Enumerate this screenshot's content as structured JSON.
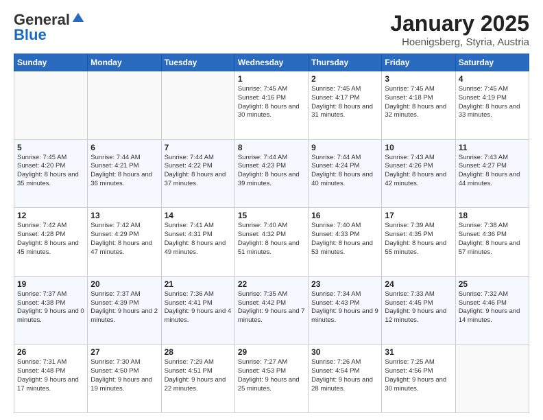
{
  "logo": {
    "general": "General",
    "blue": "Blue"
  },
  "title": "January 2025",
  "subtitle": "Hoenigsberg, Styria, Austria",
  "days_header": [
    "Sunday",
    "Monday",
    "Tuesday",
    "Wednesday",
    "Thursday",
    "Friday",
    "Saturday"
  ],
  "weeks": [
    [
      {
        "day": "",
        "info": ""
      },
      {
        "day": "",
        "info": ""
      },
      {
        "day": "",
        "info": ""
      },
      {
        "day": "1",
        "info": "Sunrise: 7:45 AM\nSunset: 4:16 PM\nDaylight: 8 hours\nand 30 minutes."
      },
      {
        "day": "2",
        "info": "Sunrise: 7:45 AM\nSunset: 4:17 PM\nDaylight: 8 hours\nand 31 minutes."
      },
      {
        "day": "3",
        "info": "Sunrise: 7:45 AM\nSunset: 4:18 PM\nDaylight: 8 hours\nand 32 minutes."
      },
      {
        "day": "4",
        "info": "Sunrise: 7:45 AM\nSunset: 4:19 PM\nDaylight: 8 hours\nand 33 minutes."
      }
    ],
    [
      {
        "day": "5",
        "info": "Sunrise: 7:45 AM\nSunset: 4:20 PM\nDaylight: 8 hours\nand 35 minutes."
      },
      {
        "day": "6",
        "info": "Sunrise: 7:44 AM\nSunset: 4:21 PM\nDaylight: 8 hours\nand 36 minutes."
      },
      {
        "day": "7",
        "info": "Sunrise: 7:44 AM\nSunset: 4:22 PM\nDaylight: 8 hours\nand 37 minutes."
      },
      {
        "day": "8",
        "info": "Sunrise: 7:44 AM\nSunset: 4:23 PM\nDaylight: 8 hours\nand 39 minutes."
      },
      {
        "day": "9",
        "info": "Sunrise: 7:44 AM\nSunset: 4:24 PM\nDaylight: 8 hours\nand 40 minutes."
      },
      {
        "day": "10",
        "info": "Sunrise: 7:43 AM\nSunset: 4:26 PM\nDaylight: 8 hours\nand 42 minutes."
      },
      {
        "day": "11",
        "info": "Sunrise: 7:43 AM\nSunset: 4:27 PM\nDaylight: 8 hours\nand 44 minutes."
      }
    ],
    [
      {
        "day": "12",
        "info": "Sunrise: 7:42 AM\nSunset: 4:28 PM\nDaylight: 8 hours\nand 45 minutes."
      },
      {
        "day": "13",
        "info": "Sunrise: 7:42 AM\nSunset: 4:29 PM\nDaylight: 8 hours\nand 47 minutes."
      },
      {
        "day": "14",
        "info": "Sunrise: 7:41 AM\nSunset: 4:31 PM\nDaylight: 8 hours\nand 49 minutes."
      },
      {
        "day": "15",
        "info": "Sunrise: 7:40 AM\nSunset: 4:32 PM\nDaylight: 8 hours\nand 51 minutes."
      },
      {
        "day": "16",
        "info": "Sunrise: 7:40 AM\nSunset: 4:33 PM\nDaylight: 8 hours\nand 53 minutes."
      },
      {
        "day": "17",
        "info": "Sunrise: 7:39 AM\nSunset: 4:35 PM\nDaylight: 8 hours\nand 55 minutes."
      },
      {
        "day": "18",
        "info": "Sunrise: 7:38 AM\nSunset: 4:36 PM\nDaylight: 8 hours\nand 57 minutes."
      }
    ],
    [
      {
        "day": "19",
        "info": "Sunrise: 7:37 AM\nSunset: 4:38 PM\nDaylight: 9 hours\nand 0 minutes."
      },
      {
        "day": "20",
        "info": "Sunrise: 7:37 AM\nSunset: 4:39 PM\nDaylight: 9 hours\nand 2 minutes."
      },
      {
        "day": "21",
        "info": "Sunrise: 7:36 AM\nSunset: 4:41 PM\nDaylight: 9 hours\nand 4 minutes."
      },
      {
        "day": "22",
        "info": "Sunrise: 7:35 AM\nSunset: 4:42 PM\nDaylight: 9 hours\nand 7 minutes."
      },
      {
        "day": "23",
        "info": "Sunrise: 7:34 AM\nSunset: 4:43 PM\nDaylight: 9 hours\nand 9 minutes."
      },
      {
        "day": "24",
        "info": "Sunrise: 7:33 AM\nSunset: 4:45 PM\nDaylight: 9 hours\nand 12 minutes."
      },
      {
        "day": "25",
        "info": "Sunrise: 7:32 AM\nSunset: 4:46 PM\nDaylight: 9 hours\nand 14 minutes."
      }
    ],
    [
      {
        "day": "26",
        "info": "Sunrise: 7:31 AM\nSunset: 4:48 PM\nDaylight: 9 hours\nand 17 minutes."
      },
      {
        "day": "27",
        "info": "Sunrise: 7:30 AM\nSunset: 4:50 PM\nDaylight: 9 hours\nand 19 minutes."
      },
      {
        "day": "28",
        "info": "Sunrise: 7:29 AM\nSunset: 4:51 PM\nDaylight: 9 hours\nand 22 minutes."
      },
      {
        "day": "29",
        "info": "Sunrise: 7:27 AM\nSunset: 4:53 PM\nDaylight: 9 hours\nand 25 minutes."
      },
      {
        "day": "30",
        "info": "Sunrise: 7:26 AM\nSunset: 4:54 PM\nDaylight: 9 hours\nand 28 minutes."
      },
      {
        "day": "31",
        "info": "Sunrise: 7:25 AM\nSunset: 4:56 PM\nDaylight: 9 hours\nand 30 minutes."
      },
      {
        "day": "",
        "info": ""
      }
    ]
  ]
}
